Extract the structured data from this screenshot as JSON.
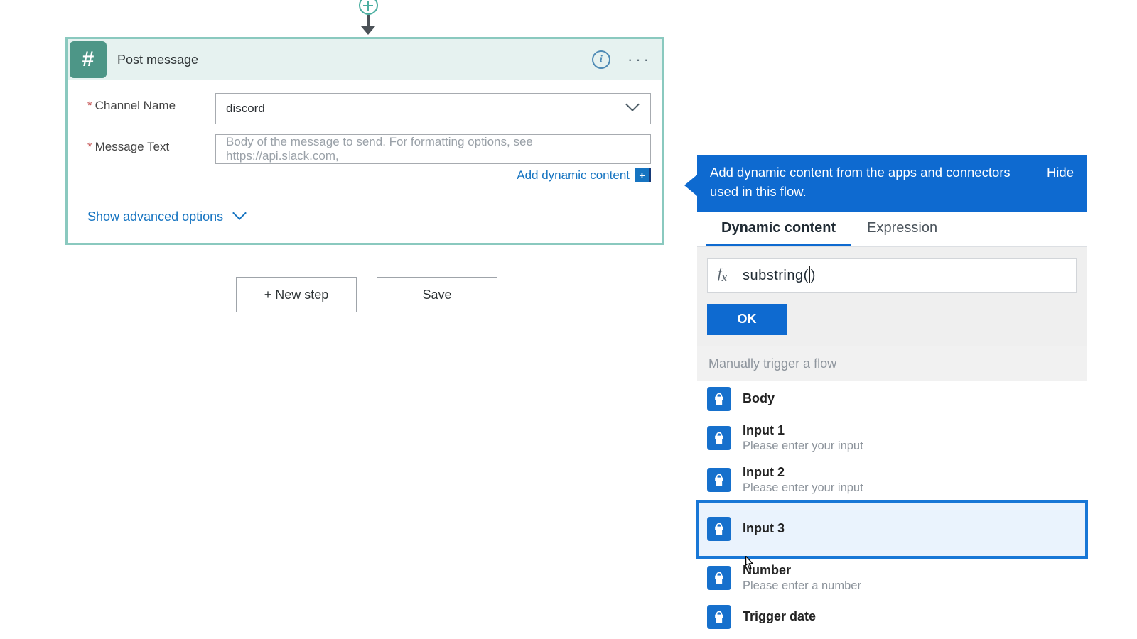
{
  "connector_icon": "add-node",
  "card": {
    "icon_glyph": "#",
    "title": "Post message",
    "info_glyph": "i",
    "more_glyph": "···",
    "channel_name_label": "Channel Name",
    "channel_name_value": "discord",
    "message_text_label": "Message Text",
    "message_text_placeholder": "Body of the message to send. For formatting options, see https://api.slack.com,",
    "add_dynamic_link": "Add dynamic content",
    "add_dynamic_badge": "+",
    "advanced_label": "Show advanced options"
  },
  "buttons": {
    "new_step": "+ New step",
    "save": "Save"
  },
  "panel": {
    "head_text": "Add dynamic content from the apps and connectors used in this flow.",
    "hide": "Hide",
    "tab_dynamic": "Dynamic content",
    "tab_expression": "Expression",
    "fx_prefix": "substring(",
    "fx_suffix": ")",
    "ok": "OK",
    "group_header": "Manually trigger a flow",
    "items": [
      {
        "title": "Body",
        "sub": null
      },
      {
        "title": "Input 1",
        "sub": "Please enter your input"
      },
      {
        "title": "Input 2",
        "sub": "Please enter your input"
      },
      {
        "title": "Input 3",
        "sub": null,
        "selected": true
      },
      {
        "title": "Number",
        "sub": "Please enter a number"
      },
      {
        "title": "Trigger date",
        "sub": null
      }
    ]
  }
}
